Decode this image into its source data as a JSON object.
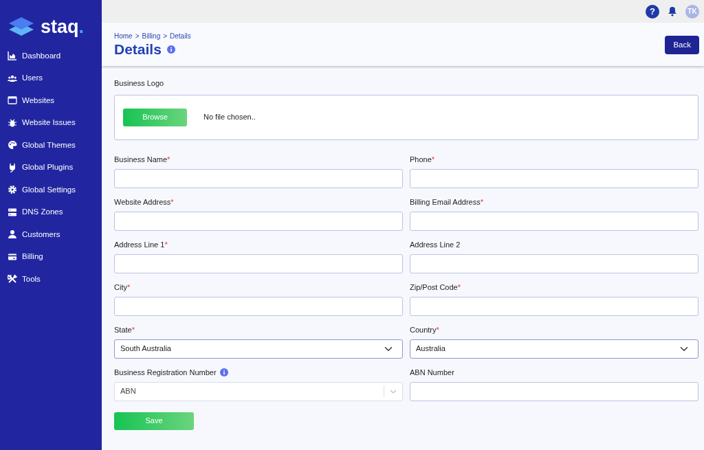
{
  "logo": {
    "text": "staq",
    "dot": "."
  },
  "sidebar": {
    "items": [
      {
        "label": "Dashboard"
      },
      {
        "label": "Users"
      },
      {
        "label": "Websites"
      },
      {
        "label": "Website Issues"
      },
      {
        "label": "Global Themes"
      },
      {
        "label": "Global Plugins"
      },
      {
        "label": "Global Settings"
      },
      {
        "label": "DNS Zones"
      },
      {
        "label": "Customers"
      },
      {
        "label": "Billing"
      },
      {
        "label": "Tools"
      }
    ]
  },
  "topbar": {
    "help": "?",
    "avatar": "TK"
  },
  "header": {
    "breadcrumb": [
      "Home",
      "Billing",
      "Details"
    ],
    "separator": ">",
    "title": "Details",
    "back_button": "Back"
  },
  "logo_upload": {
    "label": "Business Logo",
    "button": "Browse",
    "status": "No file chosen.."
  },
  "required_mark": "*",
  "fields": [
    {
      "label": "Business Name",
      "required": true,
      "kind": "text"
    },
    {
      "label": "Phone",
      "required": true,
      "kind": "text"
    },
    {
      "label": "Website Address",
      "required": true,
      "kind": "text"
    },
    {
      "label": "Billing Email Address",
      "required": true,
      "kind": "text"
    },
    {
      "label": "Address Line 1",
      "required": true,
      "kind": "text"
    },
    {
      "label": "Address Line 2",
      "required": false,
      "kind": "text"
    },
    {
      "label": "City",
      "required": true,
      "kind": "text"
    },
    {
      "label": "Zip/Post Code",
      "required": true,
      "kind": "text"
    },
    {
      "label": "State",
      "required": true,
      "kind": "select",
      "value": "South Australia"
    },
    {
      "label": "Country",
      "required": true,
      "kind": "select",
      "value": "Australia"
    },
    {
      "label": "Business Registration Number",
      "required": false,
      "info": true,
      "kind": "combo",
      "value": "ABN"
    },
    {
      "label": "ABN Number",
      "required": false,
      "kind": "text"
    }
  ],
  "save_button": "Save"
}
